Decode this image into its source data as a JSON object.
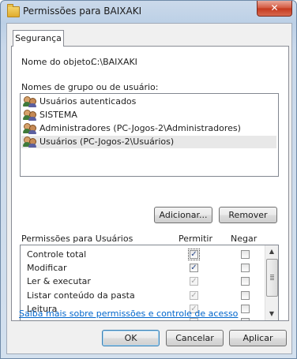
{
  "window": {
    "title": "Permissões para BAIXAKI",
    "close_glyph": "✕"
  },
  "tab": {
    "label": "Segurança"
  },
  "object": {
    "label": "Nome do objeto:",
    "value": "C:\\BAIXAKI"
  },
  "groups": {
    "label": "Nomes de grupo ou de usuário:",
    "items": [
      {
        "label": "Usuários autenticados",
        "icon": "users-icon"
      },
      {
        "label": "SISTEMA",
        "icon": "users-icon"
      },
      {
        "label": "Administradores (PC-Jogos-2\\Administradores)",
        "icon": "users-icon"
      },
      {
        "label": "Usuários (PC-Jogos-2\\Usuários)",
        "icon": "users-icon",
        "selected": true
      }
    ],
    "add_label": "Adicionar...",
    "remove_label": "Remover"
  },
  "permissions": {
    "header": "Permissões para Usuários",
    "allow_header": "Permitir",
    "deny_header": "Negar",
    "rows": [
      {
        "name": "Controle total",
        "allow": true,
        "deny": false,
        "disabled": false
      },
      {
        "name": "Modificar",
        "allow": true,
        "deny": false,
        "disabled": false
      },
      {
        "name": "Ler & executar",
        "allow": true,
        "deny": false,
        "disabled": true
      },
      {
        "name": "Listar conteúdo da pasta",
        "allow": true,
        "deny": false,
        "disabled": true
      },
      {
        "name": "Leitura",
        "allow": true,
        "deny": false,
        "disabled": true
      }
    ]
  },
  "link": "Saiba mais sobre permissões e controle de acesso",
  "buttons": {
    "ok": "OK",
    "cancel": "Cancelar",
    "apply": "Aplicar"
  },
  "colors": {
    "link": "#0066cc",
    "selection": "#e8e8e8",
    "close": "#c4381e"
  }
}
